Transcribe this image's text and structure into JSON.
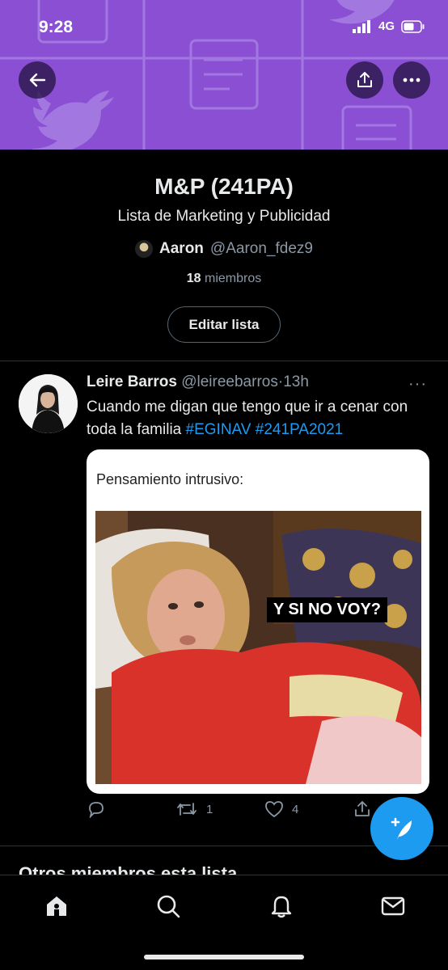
{
  "status_bar": {
    "time": "9:28",
    "network": "4G"
  },
  "banner": {
    "color": "#8a4fd3",
    "icons": [
      "back-arrow-icon",
      "share-icon",
      "more-icon"
    ]
  },
  "list": {
    "title": "M&P (241PA)",
    "description": "Lista de Marketing y Publicidad",
    "owner_name": "Aaron",
    "owner_handle": "@Aaron_fdez9",
    "members_count": "18",
    "members_label": "miembros",
    "edit_button": "Editar lista"
  },
  "tweet": {
    "author_name": "Leire Barros",
    "author_handle": "@leireebarros",
    "separator": "·",
    "time": "13h",
    "more": "···",
    "text": "Cuando me digan que tengo que ir a cenar con toda la familia ",
    "hashtags": [
      "#EGINAV",
      "#241PA2021"
    ],
    "media": {
      "caption": "Pensamiento intrusivo:",
      "overlay_text": "Y SI NO VOY?"
    },
    "actions": {
      "reply_count": "",
      "retweet_count": "1",
      "like_count": "4"
    }
  },
  "peek_text": "Otros miembros esta lista",
  "bottom_nav": {
    "items": [
      "home-icon",
      "search-icon",
      "notifications-icon",
      "messages-icon"
    ]
  },
  "colors": {
    "accent": "#1d9bf0",
    "background": "#000000",
    "secondary_text": "#8b98a5"
  }
}
